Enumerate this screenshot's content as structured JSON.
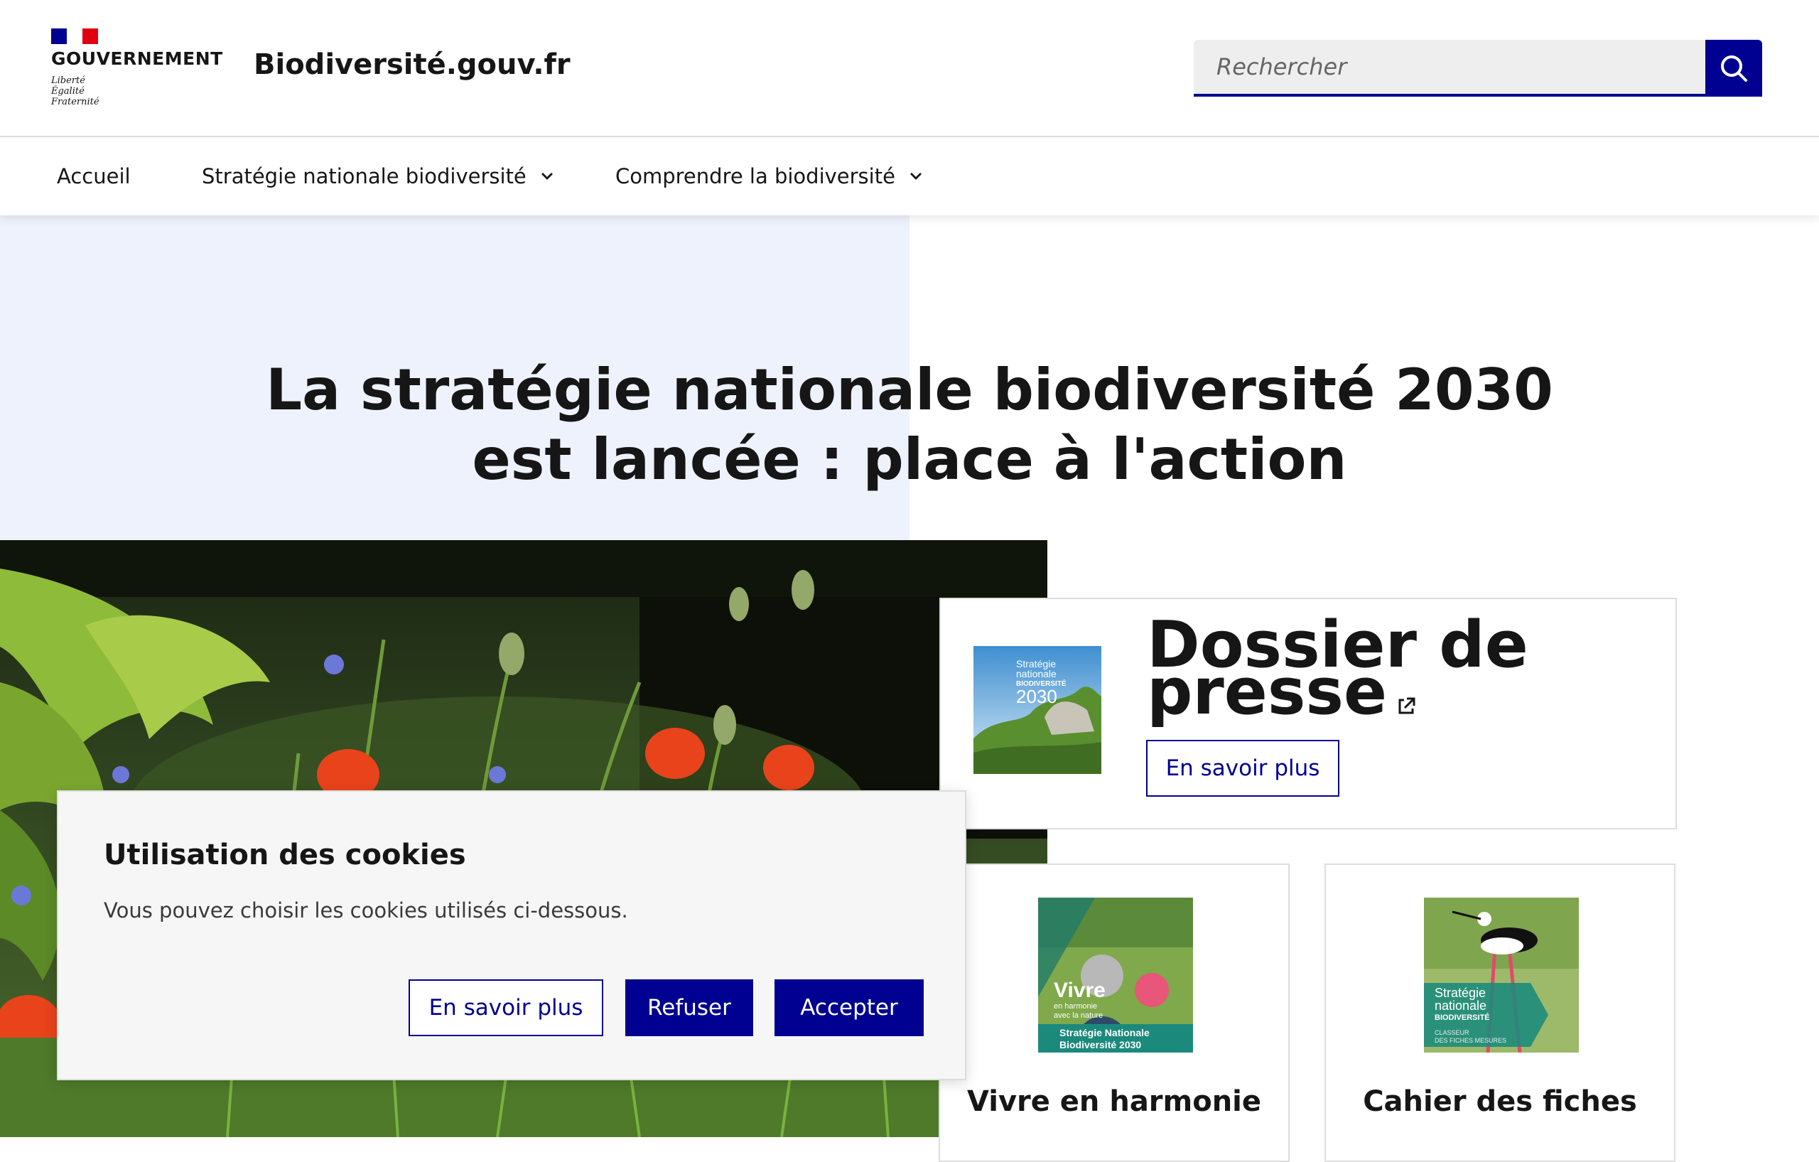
{
  "header": {
    "logo": {
      "government": "GOUVERNEMENT",
      "motto": [
        "Liberté",
        "Égalité",
        "Fraternité"
      ]
    },
    "site_name": "Biodiversité.gouv.fr",
    "search": {
      "placeholder": "Rechercher",
      "icon": "search-icon"
    }
  },
  "nav": {
    "items": [
      {
        "label": "Accueil"
      },
      {
        "label": "Stratégie nationale biodiversité",
        "icon": "chevron-down-icon"
      },
      {
        "label": "Comprendre la biodiversité",
        "icon": "chevron-down-icon"
      }
    ]
  },
  "hero": {
    "title": "La stratégie nationale biodiversité 2030 est lancée : place à l'action"
  },
  "cards": {
    "press": {
      "title": "Dossier de presse",
      "external_icon": "external-link-icon",
      "button": "En savoir plus",
      "thumb": {
        "line1": "Stratégie",
        "line2": "nationale",
        "line3": "BIODIVERSITÉ",
        "line4": "2030"
      }
    },
    "vivre": {
      "title": "Vivre en harmonie",
      "thumb": {
        "big": "Vivre",
        "small1": "en harmonie",
        "small2": "avec la nature",
        "band1": "Stratégie Nationale",
        "band2": "Biodiversité 2030"
      }
    },
    "cahier": {
      "title": "Cahier des fiches",
      "thumb": {
        "line1": "Stratégie",
        "line2": "nationale",
        "line3": "BIODIVERSITÉ",
        "line4": "CLASSEUR",
        "line5": "DES FICHES MESURES"
      }
    }
  },
  "cookie_banner": {
    "title": "Utilisation des cookies",
    "text": "Vous pouvez choisir les cookies utilisés ci-dessous.",
    "buttons": {
      "more": "En savoir plus",
      "refuse": "Refuser",
      "accept": "Accepter"
    }
  },
  "colors": {
    "primary_blue": "#000091",
    "hero_bg": "#eef2fc",
    "border": "#dddddd",
    "flag_blue": "#000091",
    "flag_red": "#e1000f"
  }
}
